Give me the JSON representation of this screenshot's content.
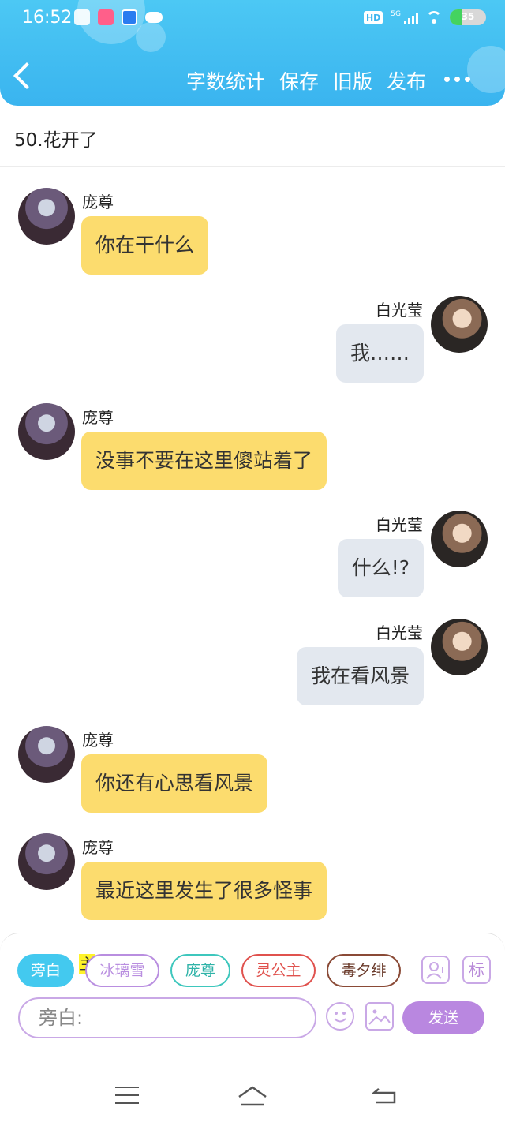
{
  "status_bar": {
    "time": "16:52",
    "hd": "HD",
    "network": "5G",
    "battery": "35",
    "battery_level": 0.35
  },
  "header": {
    "back_icon": "chevron-left-icon",
    "actions": [
      "字数统计",
      "保存",
      "旧版",
      "发布"
    ],
    "more_icon": "more-dots-icon",
    "accent": "#3ab4ef"
  },
  "chapter_title": "50.花开了",
  "messages": [
    {
      "speaker": "庞尊",
      "side": "left",
      "text": "你在干什么"
    },
    {
      "speaker": "白光莹",
      "side": "right",
      "text": "我……"
    },
    {
      "speaker": "庞尊",
      "side": "left",
      "text": "没事不要在这里傻站着了"
    },
    {
      "speaker": "白光莹",
      "side": "right",
      "text": "什么!?"
    },
    {
      "speaker": "白光莹",
      "side": "right",
      "text": "我在看风景"
    },
    {
      "speaker": "庞尊",
      "side": "left",
      "text": "你还有心思看风景"
    },
    {
      "speaker": "庞尊",
      "side": "left",
      "text": "最近这里发生了很多怪事"
    }
  ],
  "composer": {
    "characters": [
      "旁白",
      "冰璃雪",
      "庞尊",
      "灵公主",
      "毒夕绯"
    ],
    "active_character": "旁白",
    "main_badge": "主",
    "tag_button": "标",
    "input_value": "旁白:",
    "send_label": "发送",
    "colors": {
      "active": "#43c9ef",
      "bingli": "#b98ee0",
      "pangzun": "#3ec7bd",
      "linggongzhu": "#e0524e",
      "duxifei": "#8a4a36",
      "send": "#b987e0"
    }
  },
  "nav_bar": {
    "menu_icon": "menu-icon",
    "home_icon": "home-icon",
    "back_icon": "back-icon"
  }
}
